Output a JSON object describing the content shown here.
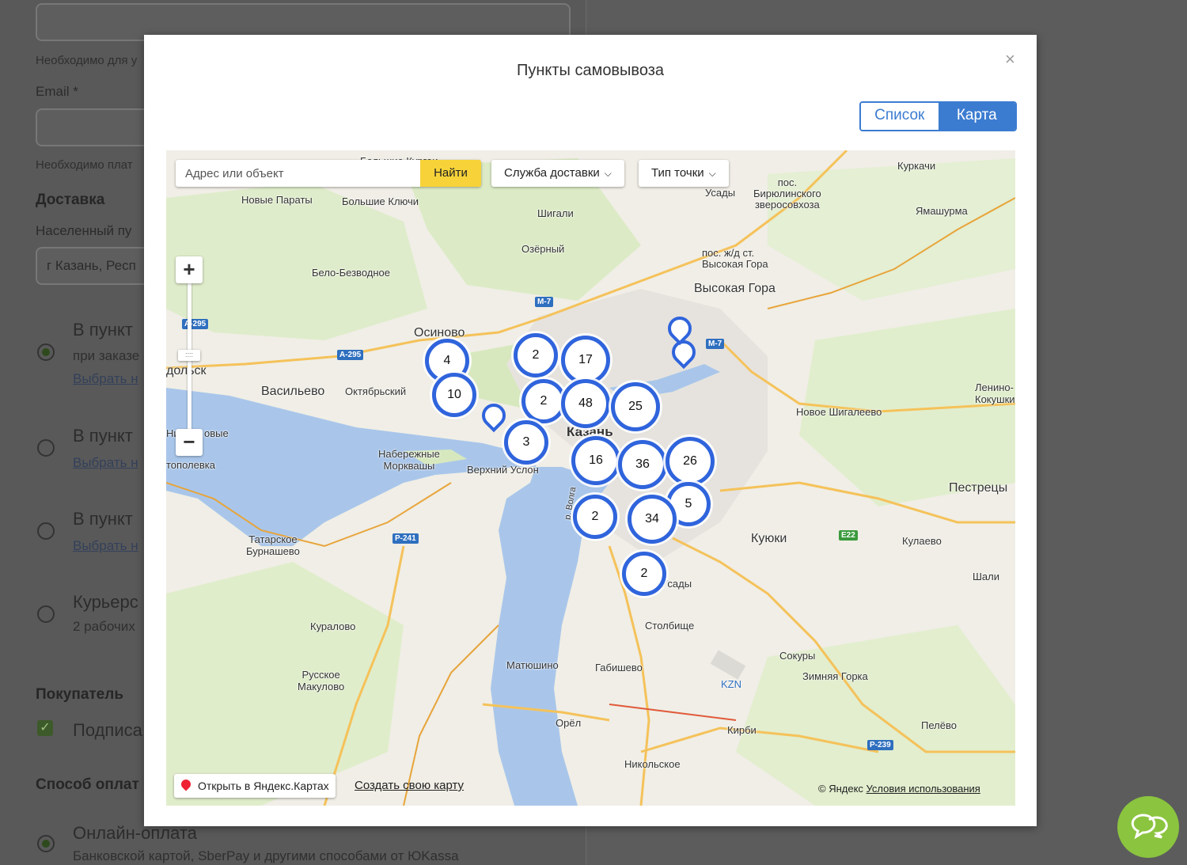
{
  "background": {
    "hint1": "Необходимо для у",
    "email_label": "Email *",
    "hint2": "Необходимо плат",
    "delivery_title": "Доставка",
    "city_label": "Населенный пу",
    "city_value": "г Казань, Респ",
    "options": [
      {
        "title": "В пункт",
        "sub": "при заказе",
        "link": "Выбрать н"
      },
      {
        "title": "В пункт",
        "link": "Выбрать н"
      },
      {
        "title": "В пункт",
        "link": "Выбрать н"
      },
      {
        "title": "Курьерс",
        "sub": "2 рабочих"
      }
    ],
    "buyer_title": "Покупатель",
    "subscribe_label": "Подписа",
    "payment_title": "Способ оплат",
    "payment_option": "Онлайн-оплата",
    "payment_sub": "Банковской картой, SberPay и другими способами от ЮKassa"
  },
  "modal": {
    "title": "Пункты самовывоза",
    "close_icon": "×",
    "tabs": {
      "list": "Список",
      "map": "Карта",
      "active": "map"
    },
    "accent_color": "#3b7cd1"
  },
  "map": {
    "search_placeholder": "Адрес или объект",
    "search_button": "Найти",
    "dropdown_service": "Служба доставки",
    "dropdown_type": "Тип точки",
    "chevron": "⌵",
    "zoom_in": "+",
    "zoom_out": "−",
    "open_in_yandex": "Открыть в Яндекс.Картах",
    "create_map": "Создать свою карту",
    "copyright": "© Яндекс",
    "terms": "Условия использования",
    "places": {
      "bolshie_kurki": "Большие Кургаи",
      "novye_paraty": "Новые Параты",
      "bolshie_klyuchi": "Большие Ключи",
      "shigali": "Шигали",
      "ozerny": "Озёрный",
      "belo_bezvodnoe": "Бело-Безводное",
      "usady_n": "Усады",
      "biryulinsky": "пос.\nБирюлинского\nзверосовхоза",
      "kurkachi": "Куркачи",
      "yamashurma": "Ямашурма",
      "vysokaya_gora_st": "пос. ж/д ст.\nВысокая Гора",
      "vysokaya_gora": "Высокая Гора",
      "osinovo": "Осиново",
      "zelenodolsk": "дольск",
      "vasilyevo": "Васильево",
      "oktyabrsky": "Октябрьский",
      "lenino": "Ленино-\nКокушки",
      "novoe_shigaleevo": "Новое Шигалеево",
      "kazan": "Казань",
      "nizhnie": "Ни",
      "novye": "овые",
      "topolevka": "тополевка",
      "naberezhnye": "Набережные\nМорквашы",
      "verkhny_uslon": "Верхний Услон",
      "volga": "р. Волга",
      "pestretsy": "Пестрецы",
      "kuyuki": "Куюки",
      "kulaevo": "Кулаево",
      "shali": "Шали",
      "tatarskoe": "Татарское\nБурнашево",
      "usady_s": "Усады",
      "stolbishche": "Столбище",
      "kuralovo": "Куралово",
      "matyushino": "Матюшино",
      "gabishevo": "Габишево",
      "sokury": "Сокуры",
      "zimnyaya_gora": "Зимняя Горка",
      "russkoe": "Русское\nМакулово",
      "orel": "Орёл",
      "kirbi": "Кирби",
      "pelevo": "Пелёво",
      "nikolskoe": "Никольское",
      "kzn": "KZN"
    },
    "roads": {
      "m7_a": "М-7",
      "m7_b": "М-7",
      "a295_a": "А-295",
      "a295_b": "А-295",
      "r241": "Р-241",
      "e22": "Е22",
      "r239": "Р-239"
    },
    "clusters": [
      {
        "count": "4"
      },
      {
        "count": "10"
      },
      {
        "count": "2"
      },
      {
        "count": "17"
      },
      {
        "count": "2"
      },
      {
        "count": "48"
      },
      {
        "count": "25"
      },
      {
        "count": "3"
      },
      {
        "count": "16"
      },
      {
        "count": "36"
      },
      {
        "count": "26"
      },
      {
        "count": "5"
      },
      {
        "count": "2"
      },
      {
        "count": "34"
      },
      {
        "count": "2"
      }
    ]
  },
  "chat_icon": "chat-bubbles-icon"
}
